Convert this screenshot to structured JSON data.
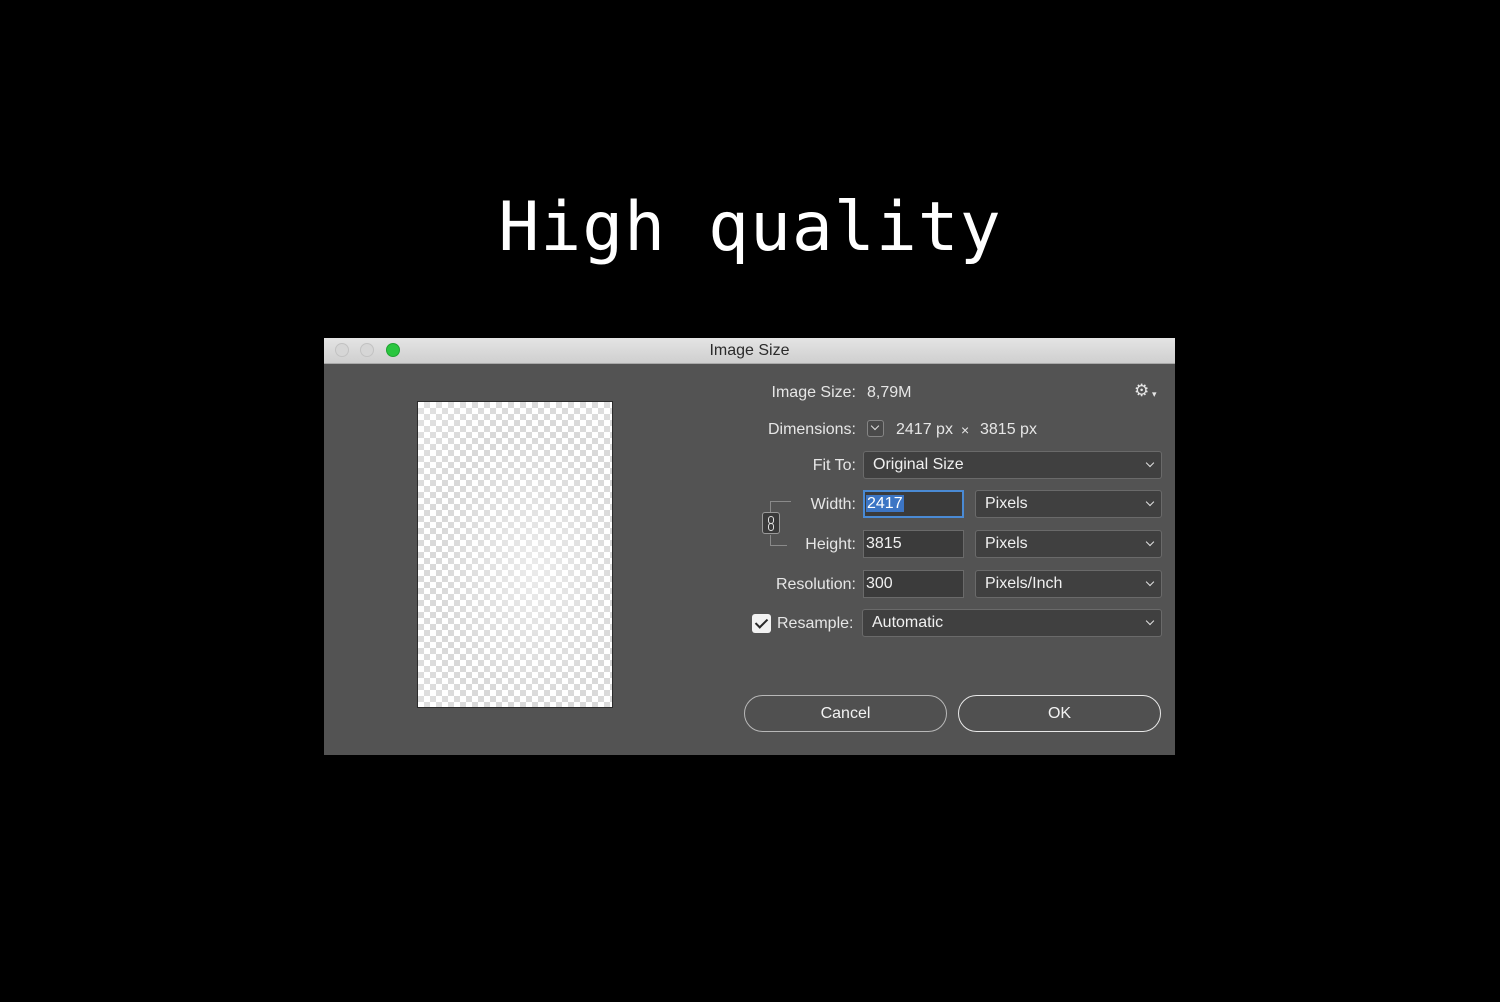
{
  "headline": "High quality",
  "window": {
    "title": "Image Size"
  },
  "image_size": {
    "label": "Image Size:",
    "value": "8,79M"
  },
  "dimensions": {
    "label": "Dimensions:",
    "width": "2417 px",
    "times": "×",
    "height": "3815 px"
  },
  "fit_to": {
    "label": "Fit To:",
    "selected": "Original Size"
  },
  "width": {
    "label": "Width:",
    "value": "2417",
    "unit": "Pixels"
  },
  "height": {
    "label": "Height:",
    "value": "3815",
    "unit": "Pixels"
  },
  "resolution": {
    "label": "Resolution:",
    "value": "300",
    "unit": "Pixels/Inch"
  },
  "resample": {
    "label": "Resample:",
    "checked": true,
    "selected": "Automatic"
  },
  "buttons": {
    "cancel": "Cancel",
    "ok": "OK"
  },
  "icons": {
    "settings": "gear-icon",
    "constrain": "chain-link-icon",
    "dropdown": "chevron-down-icon"
  },
  "colors": {
    "background": "#000000",
    "dialog": "#535353",
    "selection": "#3c75c4",
    "zoom_button": "#2ac63f"
  }
}
